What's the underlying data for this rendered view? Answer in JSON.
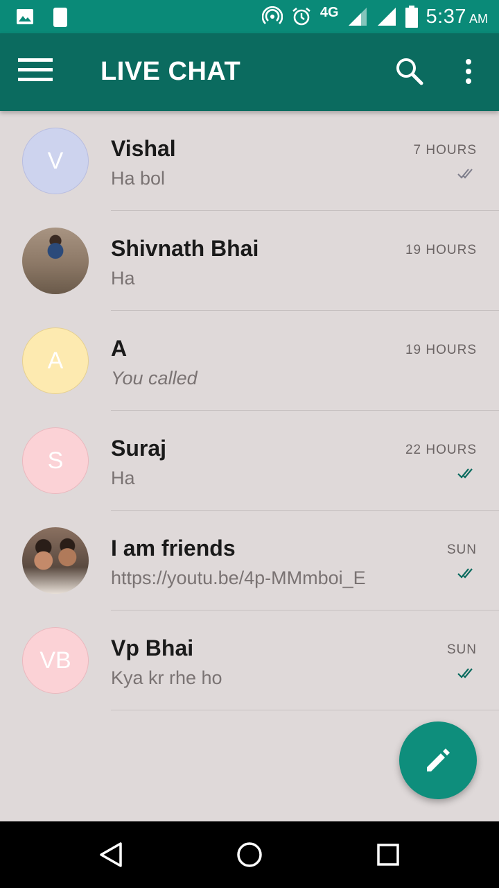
{
  "status_bar": {
    "time": "5:37",
    "ampm": "AM",
    "network": "4G",
    "icons": [
      "image-icon",
      "app-notification-icon",
      "hotspot-icon",
      "alarm-icon",
      "signal-icon",
      "signal-icon",
      "battery-icon"
    ]
  },
  "app_bar": {
    "title": "LIVE CHAT",
    "icons": [
      "menu-icon",
      "search-icon",
      "more-vert-icon"
    ],
    "color": "#0b6b5f"
  },
  "chats": [
    {
      "name": "Vishal",
      "message": "Ha bol",
      "time": "7 HOURS",
      "avatar_text": "V",
      "avatar_color": "#cdd3ee",
      "read": true,
      "read_color": "#7d7d8a"
    },
    {
      "name": "Shivnath Bhai",
      "message": "Ha",
      "time": "19 HOURS",
      "avatar_text": "",
      "avatar_color": "#7a6a5a",
      "read": false
    },
    {
      "name": "A",
      "message": "You called",
      "time": "19 HOURS",
      "avatar_text": "A",
      "avatar_color": "#fdeab0",
      "read": false
    },
    {
      "name": "Suraj",
      "message": "Ha",
      "time": "22 HOURS",
      "avatar_text": "S",
      "avatar_color": "#fbd2d6",
      "read": true,
      "read_color": "#0b6b5f"
    },
    {
      "name": "I am friends",
      "message": "https://youtu.be/4p-MMmboi_E",
      "time": "SUN",
      "avatar_text": "",
      "avatar_color": "#8a7a6a",
      "read": true,
      "read_color": "#0b6b5f"
    },
    {
      "name": "Vp Bhai",
      "message": "Kya kr rhe ho",
      "time": "SUN",
      "avatar_text": "VB",
      "avatar_color": "#fbd2d6",
      "read": true,
      "read_color": "#0b6b5f"
    }
  ],
  "fab": {
    "icon": "edit-icon",
    "color": "#0e8e7c"
  },
  "nav_bar": {
    "icons": [
      "back-icon",
      "home-icon",
      "recents-icon"
    ]
  }
}
